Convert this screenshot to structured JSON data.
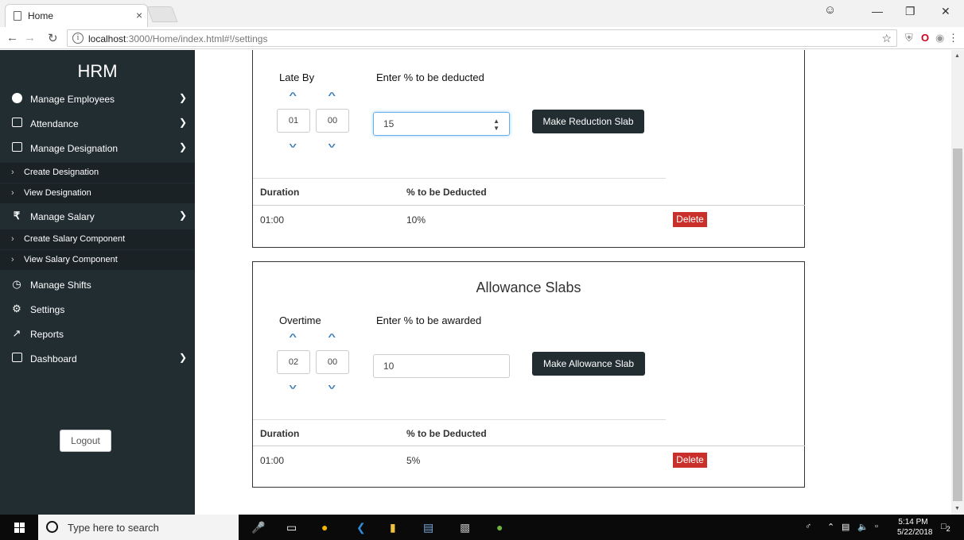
{
  "browser": {
    "tab_title": "Home",
    "tab_close": "×",
    "url_host": "localhost",
    "url_rest": ":3000/Home/index.html#!/settings",
    "window_controls": [
      "—",
      "❐",
      "✕"
    ]
  },
  "sidebar": {
    "brand": "HRM",
    "items": [
      {
        "label": "Manage Employees",
        "icon": "user-circle-icon",
        "has_chevron": true
      },
      {
        "label": "Attendance",
        "icon": "calendar-check-icon",
        "has_chevron": true
      },
      {
        "label": "Manage Designation",
        "icon": "id-badge-icon",
        "has_chevron": true
      },
      {
        "label": "Create Designation",
        "sub": true
      },
      {
        "label": "View Designation",
        "sub": true
      },
      {
        "label": "Manage Salary",
        "icon": "rupee-icon",
        "has_chevron": true
      },
      {
        "label": "Create Salary Component",
        "sub": true
      },
      {
        "label": "View Salary Component",
        "sub": true
      },
      {
        "label": "Manage Shifts",
        "icon": "clock-icon"
      },
      {
        "label": "Settings",
        "icon": "gear-icon"
      },
      {
        "label": "Reports",
        "icon": "line-chart-icon"
      },
      {
        "label": "Dashboard",
        "icon": "calendar-check-icon",
        "has_chevron": true
      }
    ],
    "logout": "Logout"
  },
  "reduction": {
    "time_label": "Late By",
    "percent_label": "Enter % to be deducted",
    "hours": "01",
    "minutes": "00",
    "percent_value": "15",
    "button": "Make Reduction Slab",
    "table_headers": [
      "Duration",
      "% to be Deducted"
    ],
    "rows": [
      {
        "duration": "01:00",
        "percent": "10%",
        "action": "Delete"
      }
    ]
  },
  "allowance": {
    "title": "Allowance Slabs",
    "time_label": "Overtime",
    "percent_label": "Enter % to be awarded",
    "hours": "02",
    "minutes": "00",
    "percent_value": "10",
    "button": "Make Allowance Slab",
    "table_headers": [
      "Duration",
      "% to be Deducted"
    ],
    "rows": [
      {
        "duration": "01:00",
        "percent": "5%",
        "action": "Delete"
      }
    ]
  },
  "taskbar": {
    "search_placeholder": "Type here to search",
    "time": "5:14 PM",
    "date": "5/22/2018",
    "notifications": "2"
  },
  "colors": {
    "sidebar_bg": "#222d32",
    "sidebar_sub_bg": "#1a2226",
    "button_dark": "#222d32",
    "delete_red": "#c9302c",
    "caret_blue": "#337ab7"
  }
}
